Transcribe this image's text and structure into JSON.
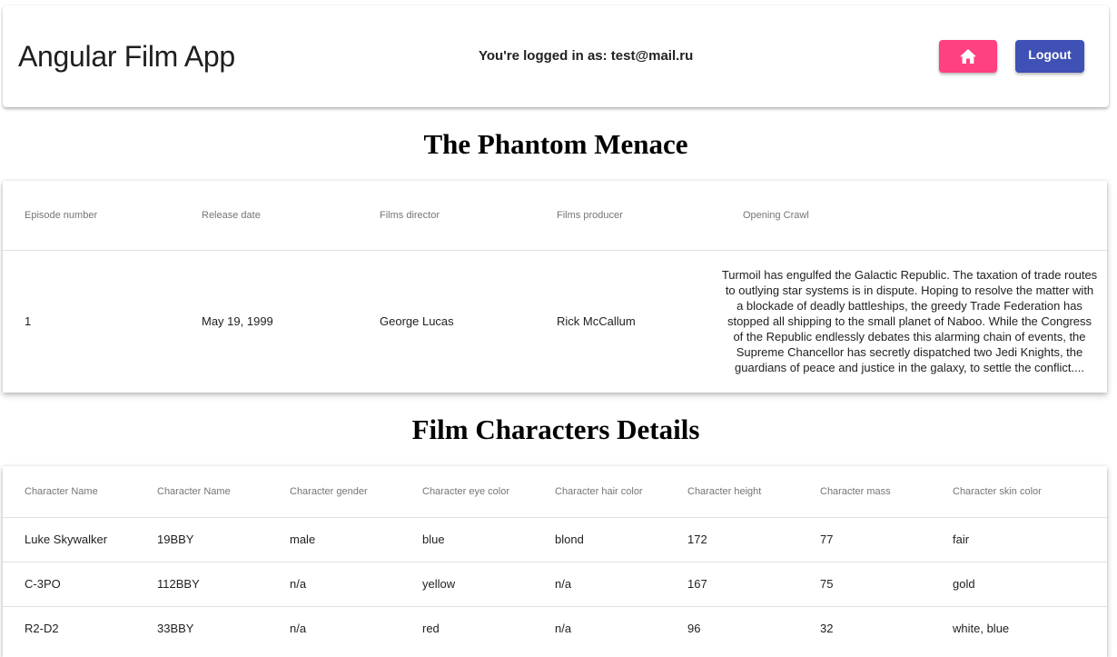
{
  "header": {
    "app_title": "Angular Film App",
    "logged_in_text": "You're logged in as: test@mail.ru",
    "home_icon": "home-icon",
    "logout_label": "Logout",
    "colors": {
      "home_button": "#ff4081",
      "logout_button": "#3f51b5"
    }
  },
  "film": {
    "title": "The Phantom Menace",
    "columns": [
      "Episode number",
      "Release date",
      "Films director",
      "Films producer",
      "Opening Crawl"
    ],
    "row": {
      "episode": "1",
      "release_date": "May 19, 1999",
      "director": "George Lucas",
      "producer": "Rick McCallum",
      "opening_crawl": "Turmoil has engulfed the Galactic Republic. The taxation of trade routes to outlying star systems is in dispute.  Hoping to resolve the matter with a blockade of deadly battleships, the greedy Trade Federation has stopped all shipping to the small planet of Naboo.  While the Congress of the Republic endlessly debates this alarming chain of events, the Supreme Chancellor has secretly dispatched two Jedi Knights, the guardians of peace and justice in the galaxy, to settle the conflict...."
    }
  },
  "characters": {
    "title": "Film Characters Details",
    "columns": [
      "Character Name",
      "Character Name",
      "Character gender",
      "Character eye color",
      "Character hair color",
      "Character height",
      "Character mass",
      "Character skin color"
    ],
    "rows": [
      [
        "Luke Skywalker",
        "19BBY",
        "male",
        "blue",
        "blond",
        "172",
        "77",
        "fair"
      ],
      [
        "C-3PO",
        "112BBY",
        "n/a",
        "yellow",
        "n/a",
        "167",
        "75",
        "gold"
      ],
      [
        "R2-D2",
        "33BBY",
        "n/a",
        "red",
        "n/a",
        "96",
        "32",
        "white, blue"
      ]
    ]
  }
}
